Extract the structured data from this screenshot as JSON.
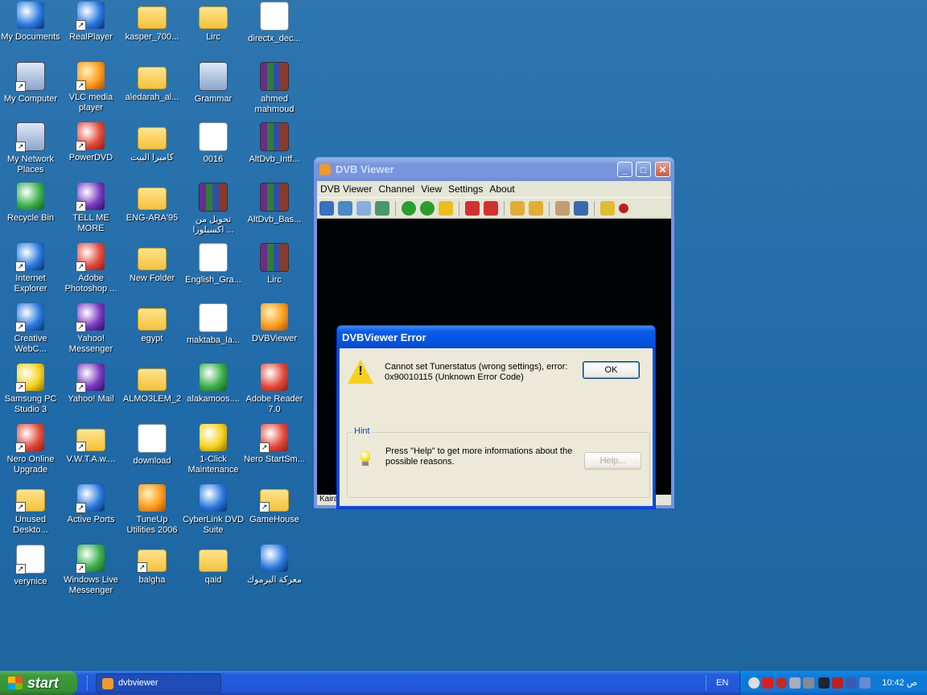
{
  "desktop": {
    "icons": [
      {
        "label": "My Documents",
        "icon": "my-documents-icon"
      },
      {
        "label": "RealPlayer",
        "icon": "realplayer-icon"
      },
      {
        "label": "kasper_700...",
        "icon": "folder-icon"
      },
      {
        "label": "Lirc",
        "icon": "folder-icon"
      },
      {
        "label": "directx_dec...",
        "icon": "installer-icon"
      },
      {
        "label": "My Computer",
        "icon": "my-computer-icon"
      },
      {
        "label": "VLC media player",
        "icon": "vlc-icon"
      },
      {
        "label": "aledarah_al...",
        "icon": "folder-icon"
      },
      {
        "label": "Grammar",
        "icon": "computer-icon"
      },
      {
        "label": "ahmed mahmoud",
        "icon": "winrar-archive-icon"
      },
      {
        "label": "My Network Places",
        "icon": "network-places-icon"
      },
      {
        "label": "PowerDVD",
        "icon": "powerdvd-icon"
      },
      {
        "label": "كاميرا البيت",
        "icon": "folder-icon"
      },
      {
        "label": "0016",
        "icon": "pdf-document-icon"
      },
      {
        "label": "AltDvb_Intf...",
        "icon": "winrar-archive-icon"
      },
      {
        "label": "Recycle Bin",
        "icon": "recycle-bin-icon"
      },
      {
        "label": "TELL ME MORE",
        "icon": "tell-me-more-icon"
      },
      {
        "label": "ENG-ARA'95",
        "icon": "folder-icon"
      },
      {
        "label": "تحويل من اكسيلورا ...",
        "icon": "winrar-archive-icon"
      },
      {
        "label": "AltDvb_Bas...",
        "icon": "winrar-archive-icon"
      },
      {
        "label": "Internet Explorer",
        "icon": "internet-explorer-icon"
      },
      {
        "label": "Adobe Photoshop ...",
        "icon": "photoshop-icon"
      },
      {
        "label": "New Folder",
        "icon": "folder-icon"
      },
      {
        "label": "English_Gra...",
        "icon": "document-icon"
      },
      {
        "label": "Lirc",
        "icon": "winrar-archive-icon"
      },
      {
        "label": "Creative WebC...",
        "icon": "webcam-icon"
      },
      {
        "label": "Yahoo! Messenger",
        "icon": "yahoo-messenger-icon"
      },
      {
        "label": "egypt",
        "icon": "folder-icon"
      },
      {
        "label": "maktaba_la...",
        "icon": "book-icon"
      },
      {
        "label": "DVBViewer",
        "icon": "dvbviewer-icon"
      },
      {
        "label": "Samsung PC Studio 3",
        "icon": "samsung-pc-studio-icon"
      },
      {
        "label": "Yahoo! Mail",
        "icon": "yahoo-mail-icon"
      },
      {
        "label": "ALMO3LEM_2",
        "icon": "folder-icon"
      },
      {
        "label": "alakamoos....",
        "icon": "alakamoos-icon"
      },
      {
        "label": "Adobe Reader 7.0",
        "icon": "adobe-reader-icon"
      },
      {
        "label": "Nero Online Upgrade",
        "icon": "nero-upgrade-icon"
      },
      {
        "label": "V.W.T.A.w....",
        "icon": "folder-icon"
      },
      {
        "label": "download",
        "icon": "excel-document-icon"
      },
      {
        "label": "1-Click Maintenance",
        "icon": "maintenance-icon"
      },
      {
        "label": "Nero StartSm...",
        "icon": "nero-icon"
      },
      {
        "label": "Unused Deskto...",
        "icon": "folder-icon"
      },
      {
        "label": "Active Ports",
        "icon": "active-ports-icon"
      },
      {
        "label": "TuneUp Utilities 2006",
        "icon": "tuneup-icon"
      },
      {
        "label": "CyberLink DVD Suite",
        "icon": "cyberlink-icon"
      },
      {
        "label": "GameHouse",
        "icon": "folder-icon"
      },
      {
        "label": "verynice",
        "icon": "document-icon"
      },
      {
        "label": "Windows Live Messenger",
        "icon": "live-messenger-icon"
      },
      {
        "label": "balgha",
        "icon": "folder-icon"
      },
      {
        "label": "qaid",
        "icon": "folder-icon"
      },
      {
        "label": "معركة اليرموك",
        "icon": "media-file-icon"
      }
    ]
  },
  "dvb_window": {
    "title": "DVB Viewer",
    "menu": [
      "DVB Viewer",
      "Channel",
      "View",
      "Settings",
      "About"
    ],
    "status_text": "Kaira"
  },
  "error_dialog": {
    "title": "DVBViewer Error",
    "message": "Cannot set Tunerstatus (wrong settings), error: 0x90010115 (Unknown Error Code)",
    "ok_label": "OK",
    "hint_legend": "Hint",
    "hint_text": "Press \"Help\" to get more informations about the possible reasons.",
    "help_label": "Help..."
  },
  "taskbar": {
    "start_label": "start",
    "task_label": "dvbviewer",
    "language": "EN",
    "clock": "10:42 ص"
  }
}
